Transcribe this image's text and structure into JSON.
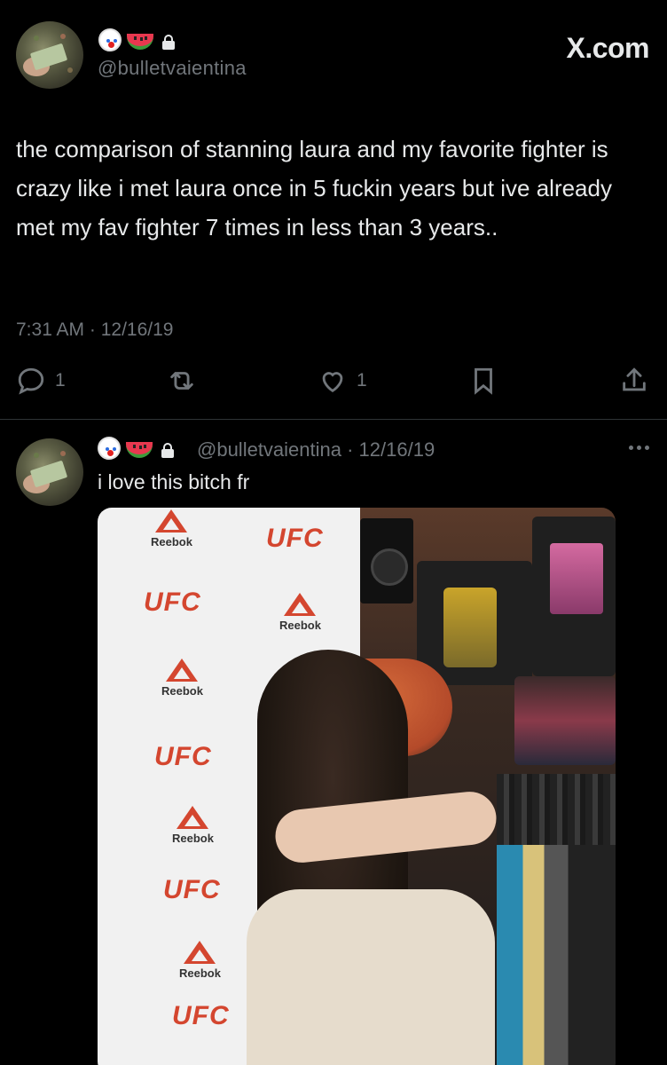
{
  "main_tweet": {
    "handle": "@bulletvaientina",
    "site": "X.com",
    "text": "the comparison of stanning laura and my favorite fighter is crazy like i met laura once in 5 fuckin years but ive already met my fav fighter 7 times in less than 3 years..",
    "timestamp": "7:31 AM · 12/16/19",
    "reply_count": "1",
    "like_count": "1"
  },
  "reply_tweet": {
    "handle_date": "@bulletvaientina · 12/16/19",
    "text": "i love this bitch fr",
    "photo": {
      "brand_a": "UFC",
      "brand_b": "Reebok"
    }
  },
  "icons": [
    "clown-emoji",
    "watermelon-emoji",
    "lock-icon",
    "reply-icon",
    "retweet-icon",
    "like-icon",
    "bookmark-icon",
    "share-icon",
    "more-icon"
  ],
  "colors": {
    "background": "#000000",
    "text": "#e7e9ea",
    "secondary": "#71767b",
    "divider": "#2f3336",
    "brand_red": "#d4462f"
  }
}
